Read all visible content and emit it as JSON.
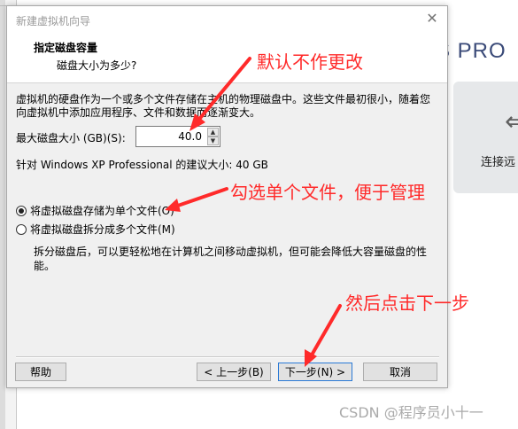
{
  "background": {
    "brand_text": "S PRO",
    "tile_label": "连接远",
    "tile_icon": "arrow-back-icon"
  },
  "dialog": {
    "title": "新建虚拟机向导",
    "close_symbol": "✕",
    "header_title": "指定磁盘容量",
    "header_subtitle": "磁盘大小为多少?",
    "description": "虚拟机的硬盘作为一个或多个文件存储在主机的物理磁盘中。这些文件最初很小，随着您向虚拟机中添加应用程序、文件和数据而逐渐变大。",
    "max_size_label": "最大磁盘大小 (GB)(S):",
    "max_size_value": "40.0",
    "recommend_text": "针对 Windows XP Professional 的建议大小: 40 GB",
    "radio_single_label": "将虚拟磁盘存储为单个文件(O)",
    "radio_split_label": "将虚拟磁盘拆分成多个文件(M)",
    "split_description": "拆分磁盘后，可以更轻松地在计算机之间移动虚拟机，但可能会降低大容量磁盘的性能。",
    "buttons": {
      "help": "帮助",
      "back": "< 上一步(B)",
      "next": "下一步(N) >",
      "cancel": "取消"
    }
  },
  "annotations": {
    "default_note": "默认不作更改",
    "single_file_note": "勾选单个文件，便于管理",
    "next_note": "然后点击下一步",
    "color": "#ff2a2a"
  },
  "watermark": "CSDN @程序员小十一"
}
